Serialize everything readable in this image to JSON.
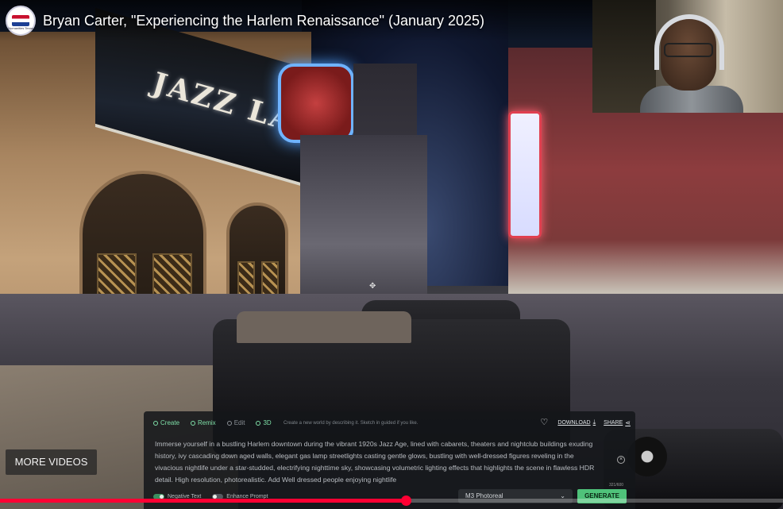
{
  "video": {
    "title": "Bryan Carter, \"Experiencing the Harlem Renaissance\" (January 2025)",
    "scene_sign_text": "JAZZ LAHH",
    "channel_logo_caption": "Humanities Texas"
  },
  "generator": {
    "tabs": [
      {
        "label": "Create",
        "active": true
      },
      {
        "label": "Remix",
        "active": false
      },
      {
        "label": "Edit",
        "active": false
      },
      {
        "label": "3D",
        "active": false
      }
    ],
    "hint": "Create a new world by describing it. Sketch in guided if you like.",
    "download_label": "DOWNLOAD",
    "share_label": "SHARE",
    "prompt": "Immerse yourself in a bustling Harlem downtown during the vibrant 1920s Jazz Age, lined with cabarets, theaters and nightclub buildings exuding history, ivy cascading down aged walls, elegant gas lamp streetlights casting gentle glows, bustling with well-dressed figures reveling in the vivacious nightlife under a star-studded, electrifying nighttime sky, showcasing volumetric lighting effects that highlights the scene in flawless HDR detail. High resolution, photorealistic. Add Well dressed people enjoying nightlife",
    "char_count": "321/600",
    "negative_text_label": "Negative Text",
    "enhance_prompt_label": "Enhance Prompt",
    "model_value": "M3 Photoreal",
    "generate_label": "GENERATE"
  },
  "player": {
    "more_videos_label": "MORE VIDEOS",
    "progress": 0.518
  },
  "colors": {
    "progress": "#ff0033",
    "generate_button": "#4fc27a",
    "active_tab": "#7fe0a8"
  }
}
